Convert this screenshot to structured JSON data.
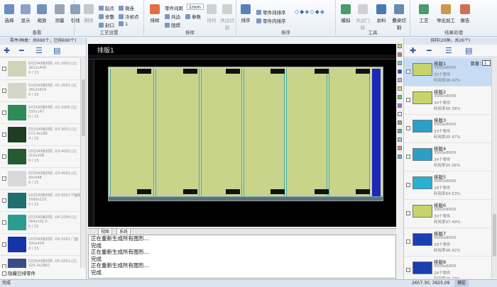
{
  "ribbon": {
    "groups": [
      {
        "label": "查看",
        "buttons": [
          "选择",
          "显示",
          "缩放",
          "测量"
        ]
      },
      {
        "label": "工艺设置",
        "buttons": [
          "引线",
          "删除"
        ],
        "small": [
          "起点",
          "微连",
          "修整",
          "冷却点",
          "封口",
          "1"
        ]
      },
      {
        "label": "排样",
        "buttons": [
          "排样"
        ],
        "small": [
          "零件间距",
          "1mm",
          "共边",
          "参数",
          "阻焊"
        ],
        "dim": [
          "排列",
          "共边切割"
        ]
      },
      {
        "label": "排序",
        "buttons": [
          "排序"
        ],
        "small": [
          "零件间排序",
          "零件内排序"
        ]
      },
      {
        "label": "工具",
        "buttons": [
          "模拟",
          "共边门除",
          "余料",
          "叠梁切割"
        ]
      },
      {
        "label": "结果处理",
        "buttons": [
          "工艺",
          "导出加工",
          "报告"
        ]
      }
    ]
  },
  "left_panel": {
    "header": "零件(种类：共690个，已排690个)",
    "parts": [
      {
        "name": "GY2540板材机 -01-1002-[1]",
        "size": "2812x400",
        "count": "0 / 15",
        "color": "#cfd4b8"
      },
      {
        "name": "GY2540板材机 -01-2002-[1]",
        "size": "2812x624",
        "count": "0 / 15",
        "color": "#d4d6c8"
      },
      {
        "name": "GY2540板材机 -02-1005-[1]",
        "size": "335x147",
        "count": "0 / 15",
        "color": "#2e8b57"
      },
      {
        "name": "GY2540板材机 -03-3001-[1]",
        "size": "172.4x186",
        "count": "0 / 15",
        "color": "#1e3d22"
      },
      {
        "name": "GY2540板材机 -03-4003-[1]",
        "size": "210x308",
        "count": "0 / 15",
        "color": "#245b33"
      },
      {
        "name": "GY2540板材机 -03-4003-[1]",
        "size": "30x548",
        "count": "0 / 15",
        "color": "#d8d8d8"
      },
      {
        "name": "GY2540板材机 -03-5001下轴组",
        "size": "1660x210",
        "count": "0 / 15",
        "color": "#1f6f6f"
      },
      {
        "name": "GY2540板材机 -04-1004-[1]",
        "size": "364x101.5",
        "count": "0 / 15",
        "color": "#2a9d8f"
      },
      {
        "name": "GY2540板材机 -04-1001 门面",
        "size": "290x404",
        "count": "0 / 15",
        "color": "#1633a8"
      },
      {
        "name": "GY2540板材机 -05-1001-[1]",
        "size": "329.3x2882",
        "count": "0 / 15",
        "color": "#3c4a8a"
      }
    ],
    "hide_label": "隐藏已排零件"
  },
  "canvas": {
    "tab": "排版1"
  },
  "bottom_tabs": [
    "视图",
    "系统"
  ],
  "console": {
    "lines": [
      "正在重新生成所有图形...",
      "完成",
      "正在重新生成所有图形...",
      "完成",
      "正在重新生成所有图形...",
      "完成"
    ]
  },
  "right_panel": {
    "header": "排样(20种，共26个)",
    "qty_label": "数量：",
    "qty_value": "1",
    "layouts": [
      {
        "name": "排版1",
        "size": "3000x6000",
        "parts": "30个零件",
        "util": "利用率96.42%",
        "color": "#c8d36a"
      },
      {
        "name": "排版2",
        "size": "3000x6000",
        "parts": "30个零件",
        "util": "利用率96.38%",
        "color": "#c8d36a"
      },
      {
        "name": "排版3",
        "size": "3000x6000",
        "parts": "33个零件",
        "util": "利用率95.97%",
        "color": "#2a9fc9"
      },
      {
        "name": "排版4",
        "size": "3000x6000",
        "parts": "34个零件",
        "util": "利用率95.06%",
        "color": "#2a9fc9"
      },
      {
        "name": "排版5",
        "size": "3000x6000",
        "parts": "26个零件",
        "util": "利用率94.53%",
        "color": "#2ab0d0"
      },
      {
        "name": "排版6",
        "size": "3000x6000",
        "parts": "30个零件",
        "util": "利用率97.49%",
        "color": "#c8d36a"
      },
      {
        "name": "排版7",
        "size": "3000x6000",
        "parts": "26个零件",
        "util": "利用率96.92%",
        "color": "#1a3fb0"
      },
      {
        "name": "排版8",
        "size": "3000x6000",
        "parts": "26个零件",
        "util": "利用率96.43%",
        "color": "#1a3fb0"
      }
    ]
  },
  "status": {
    "left": "完成",
    "coord": "2657.30, 3925.09",
    "mode": "捕捉"
  },
  "colors": [
    "#c8d36a",
    "#e07070",
    "#7cc4e8",
    "#2a4fb0",
    "#e8a0e0",
    "#f0d060",
    "#70c070",
    "#a070e0",
    "#e8e8e8",
    "#d09050",
    "#60b0b0",
    "#c0c0c0",
    "#f08080",
    "#80a0f0"
  ]
}
